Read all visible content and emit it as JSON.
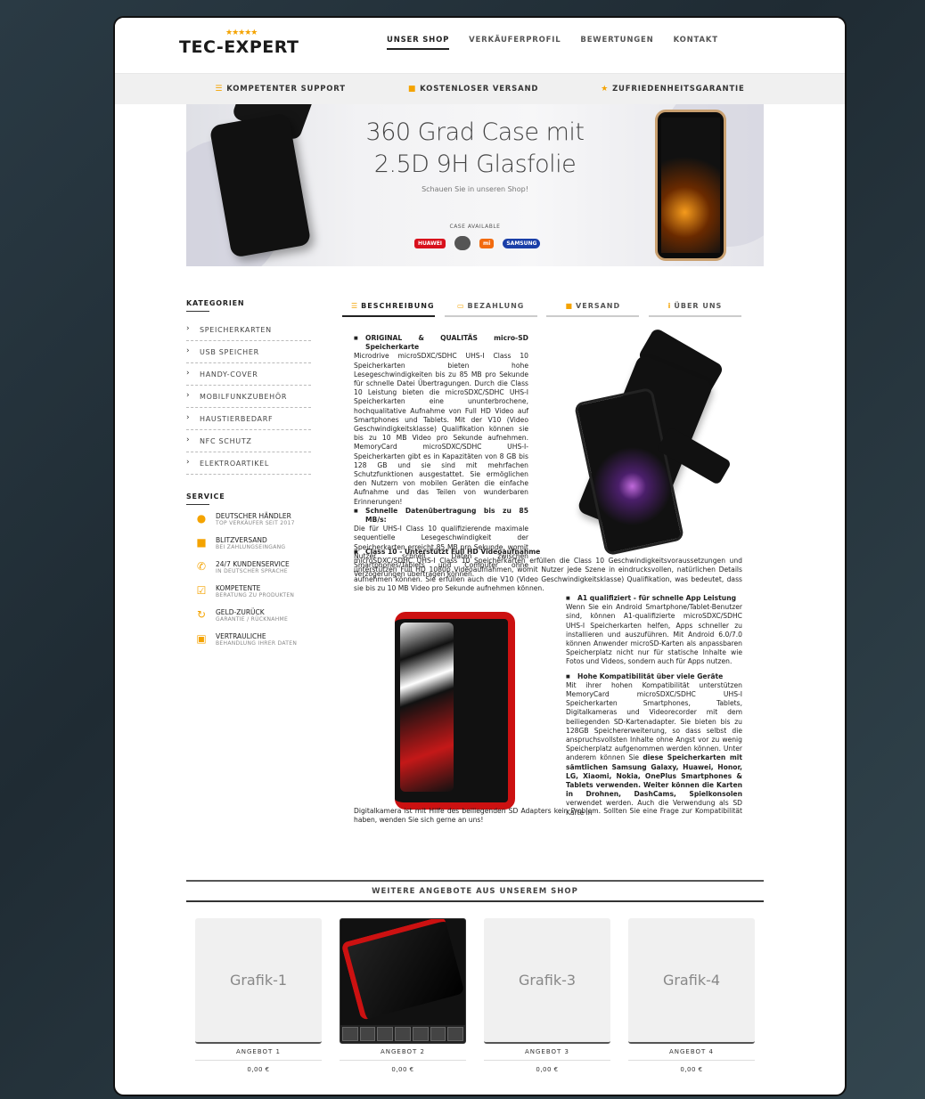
{
  "header": {
    "logo_stars": "★★★★★",
    "logo_text": "TEC-EXPERT",
    "nav": [
      "UNSER SHOP",
      "VERKÄUFERPROFIL",
      "BEWERTUNGEN",
      "KONTAKT"
    ]
  },
  "usp": [
    "KOMPETENTER SUPPORT",
    "KOSTENLOSER VERSAND",
    "ZUFRIEDENHEITSGARANTIE"
  ],
  "banner": {
    "line1": "360 Grad Case mit",
    "line2": "2.5D 9H Glasfolie",
    "sub": "Schauen Sie in unseren Shop!",
    "case_available": "CASE AVAILABLE",
    "brands": [
      "HUAWEI",
      "",
      "mi",
      "SAMSUNG"
    ]
  },
  "sidebar": {
    "categories_title": "KATEGORIEN",
    "categories": [
      "SPEICHERKARTEN",
      "USB SPEICHER",
      "HANDY-COVER",
      "MOBILFUNKZUBEHÖR",
      "HAUSTIERBEDARF",
      "NFC SCHUTZ",
      "ELEKTROARTIKEL"
    ],
    "service_title": "SERVICE",
    "services": [
      {
        "title": "DEUTSCHER HÄNDLER",
        "sub": "TOP VERKÄUFER SEIT 2017"
      },
      {
        "title": "BLITZVERSAND",
        "sub": "BEI ZAHLUNGSEINGANG"
      },
      {
        "title": "24/7 KUNDENSERVICE",
        "sub": "IN DEUTSCHER SPRACHE"
      },
      {
        "title": "KOMPETENTE",
        "sub": "BERATUNG ZU PRODUKTEN"
      },
      {
        "title": "GELD-ZURÜCK",
        "sub": "GARANTIE / RÜCKNAHME"
      },
      {
        "title": "VERTRAULICHE",
        "sub": "BEHANDLUNG IHRER DATEN"
      }
    ]
  },
  "tabs": [
    "BESCHREIBUNG",
    "BEZAHLUNG",
    "VERSAND",
    "ÜBER UNS"
  ],
  "content": {
    "h1": "ORIGINAL & QUALITÄS micro-SD Speicherkarte",
    "p1": "Microdrive microSDXC/SDHC UHS-I Class 10 Speicherkarten bieten hohe Lesegeschwindigkeiten bis zu 85 MB pro Sekunde für schnelle Datei Übertragungen. Durch die Class 10 Leistung bieten die microSDXC/SDHC UHS-I Speicherkarten eine ununterbrochene, hochqualitative Aufnahme von Full HD Video auf Smartphones und Tablets. Mit der V10 (Video Geschwindigkeitsklasse) Qualifikation können sie bis zu 10 MB Video pro Sekunde aufnehmen. MemoryCard microSDXC/SDHC UHS-I-Speicherkarten gibt es in Kapazitäten von 8 GB bis 128 GB und sie sind mit mehrfachen Schutzfunktionen ausgestattet. Sie ermöglichen den Nutzern von mobilen Geräten die einfache Aufnahme und das Teilen von wunderbaren Erinnerungen!",
    "h2": "Schnelle Datenübertragung bis zu 85 MB/s:",
    "p2": "Die für UHS-I Class 10 qualifizierende maximale sequentielle Lesegeschwindigkeit der Speicherkarten erreicht 85 MB pro Sekunde, womit Nutzer schnell Daten zwischen Smartphones/Tablets und Computer ohne Verzögerungen übertragen können.",
    "h3": "Class 10 - Unterstützt Full HD Videoaufnahme",
    "p3": "microSDXC/SDHC UHS-I Class 10 Speicherkarten erfüllen die Class 10 Geschwindigkeitsvoraussetzungen und unterstützen Full HD 1080p Videoaufnahmen, womit Nutzer jede Szene in eindrucksvollen, natürlichen Details aufnehmen können. Sie erfüllen auch die V10 (Video Geschwindigkeitsklasse) Qualifikation, was bedeutet, dass sie bis zu 10 MB Video pro Sekunde aufnehmen können.",
    "h4": "A1 qualifiziert - für schnelle App Leistung",
    "p4": "Wenn Sie ein Android Smartphone/Tablet-Benutzer sind, können A1-qualifizierte microSDXC/SDHC UHS-I Speicherkarten helfen, Apps schneller zu installieren und auszuführen. Mit Android 6.0/7.0 können Anwender microSD-Karten als anpassbaren Speicherplatz nicht nur für statische Inhalte wie Fotos und Videos, sondern auch für Apps nutzen.",
    "h5": "Hohe Kompatibilität über viele Geräte",
    "p5a": "Mit ihrer hohen Kompatibilität unterstützen MemoryCard microSDXC/SDHC UHS-I Speicherkarten Smartphones, Tablets, Digitalkameras und Videorecorder mit dem beiliegenden SD-Kartenadapter. Sie bieten bis zu 128GB Speichererweiterung, so dass selbst die anspruchsvollsten Inhalte ohne Angst vor zu wenig Speicherplatz aufgenommen werden können. Unter anderem können Sie ",
    "p5b": "diese Speicherkarten mit sämtlichen Samsung Galaxy, Huawei, Honor, LG, Xiaomi, Nokia, OnePlus Smartphones & Tablets verwenden. Weiter können die Karten in Drohnen, DashCams, Spielkonsolen",
    "p5c": " verwendet werden. Auch die Verwendung als SD Karte in",
    "p5d": "Digitalkamera ist mit Hilfe des beiliegenden SD Adapters kein Problem. Sollten Sie eine Frage zur Kompatibilität haben, wenden Sie sich gerne an uns!"
  },
  "more": {
    "title": "WEITERE ANGEBOTE AUS UNSEREM SHOP",
    "offers": [
      {
        "img_label": "Grafik-1",
        "label": "ANGEBOT 1",
        "price": "0,00 €"
      },
      {
        "img_label": "",
        "label": "ANGEBOT 2",
        "price": "0,00 €"
      },
      {
        "img_label": "Grafik-3",
        "label": "ANGEBOT 3",
        "price": "0,00 €"
      },
      {
        "img_label": "Grafik-4",
        "label": "ANGEBOT 4",
        "price": "0,00 €"
      }
    ]
  },
  "colors": {
    "accent": "#f4a300",
    "brand_dark": "#1a1a1a"
  }
}
